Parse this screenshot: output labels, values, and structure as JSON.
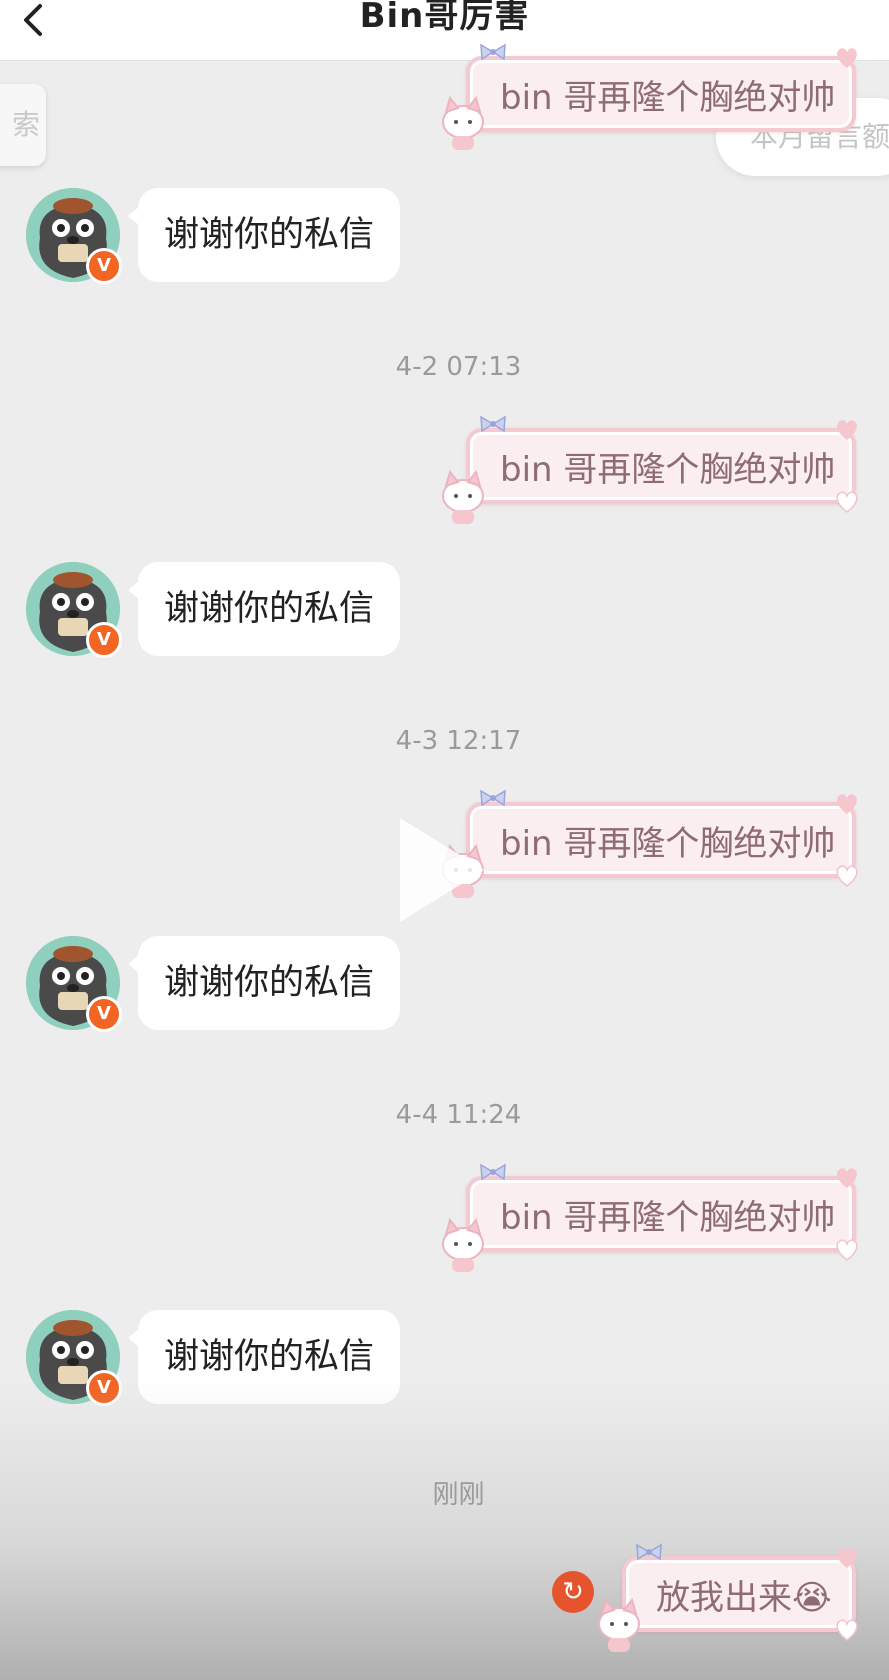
{
  "header": {
    "title": "Bin哥厉害"
  },
  "search_tab": {
    "text": "索"
  },
  "monthly_pill": {
    "text": "本月留言额"
  },
  "messages": {
    "sent_text": "bin 哥再隆个胸绝对帅",
    "reply_text": "谢谢你的私信",
    "timestamps": [
      "4-2 07:13",
      "4-3 12:17",
      "4-4 11:24",
      "刚刚"
    ],
    "final_text": "放我出来😭"
  },
  "badges": {
    "verified": "V",
    "retry_icon": "↻"
  },
  "colors": {
    "accent_orange": "#f26522",
    "sticker_text": "#8f6c74",
    "sticker_border": "#f4c9d0"
  }
}
